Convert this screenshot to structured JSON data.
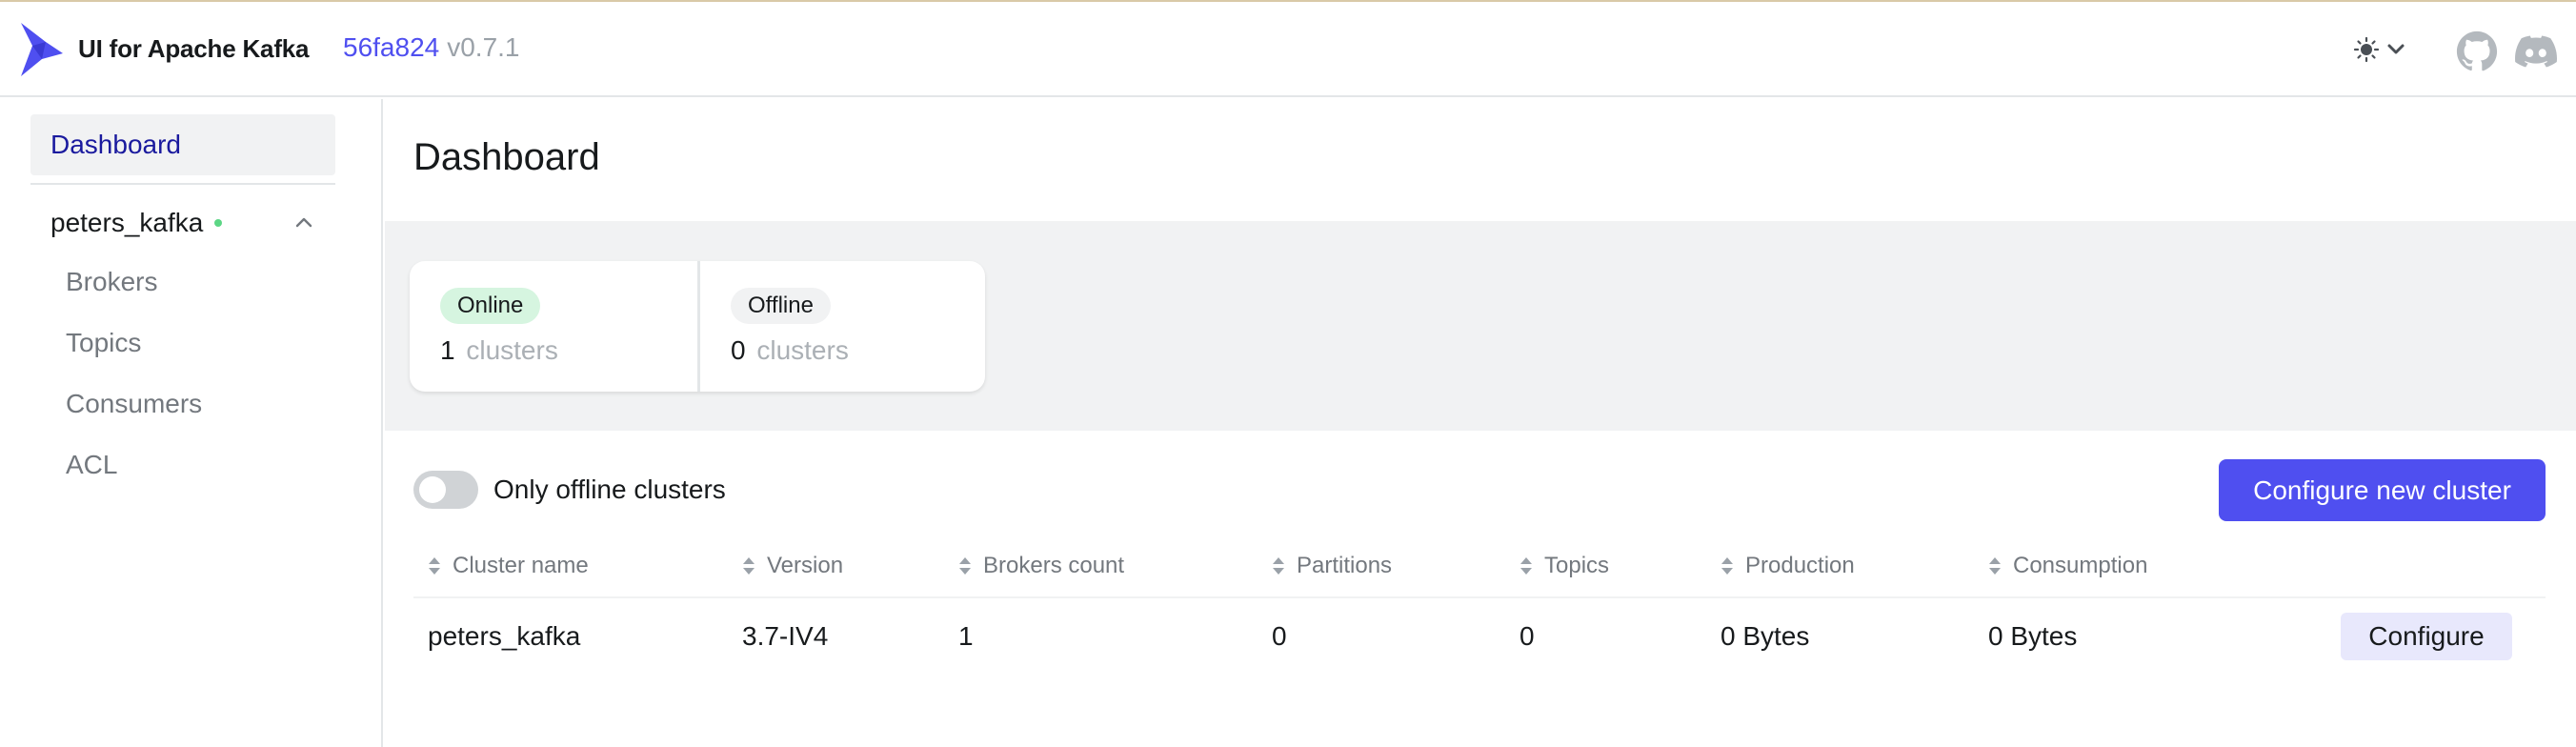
{
  "header": {
    "app_title": "UI for Apache Kafka",
    "commit": "56fa824",
    "version": "v0.7.1",
    "icons": [
      "kafka-logo",
      "sun-icon",
      "chevron-down-icon",
      "github-icon",
      "discord-icon"
    ]
  },
  "sidebar": {
    "dashboard_label": "Dashboard",
    "cluster": {
      "name": "peters_kafka",
      "status": "online",
      "items": [
        {
          "label": "Brokers"
        },
        {
          "label": "Topics"
        },
        {
          "label": "Consumers"
        },
        {
          "label": "ACL"
        }
      ]
    }
  },
  "main": {
    "title": "Dashboard",
    "metrics": {
      "online": {
        "badge": "Online",
        "value": "1",
        "unit": "clusters"
      },
      "offline": {
        "badge": "Offline",
        "value": "0",
        "unit": "clusters"
      }
    },
    "toggle": {
      "label": "Only offline clusters",
      "on": false
    },
    "configure_new_button": "Configure new cluster",
    "table": {
      "columns": [
        "Cluster name",
        "Version",
        "Brokers count",
        "Partitions",
        "Topics",
        "Production",
        "Consumption"
      ],
      "rows": [
        {
          "cluster_name": "peters_kafka",
          "version": "3.7-IV4",
          "brokers_count": "1",
          "partitions": "0",
          "topics": "0",
          "production": "0 Bytes",
          "consumption": "0 Bytes",
          "action": "Configure"
        }
      ]
    }
  },
  "colors": {
    "accent": "#4f4ff0",
    "online_badge": "#d6f5e0",
    "status_dot": "#5cd685",
    "band": "#f1f2f3"
  }
}
